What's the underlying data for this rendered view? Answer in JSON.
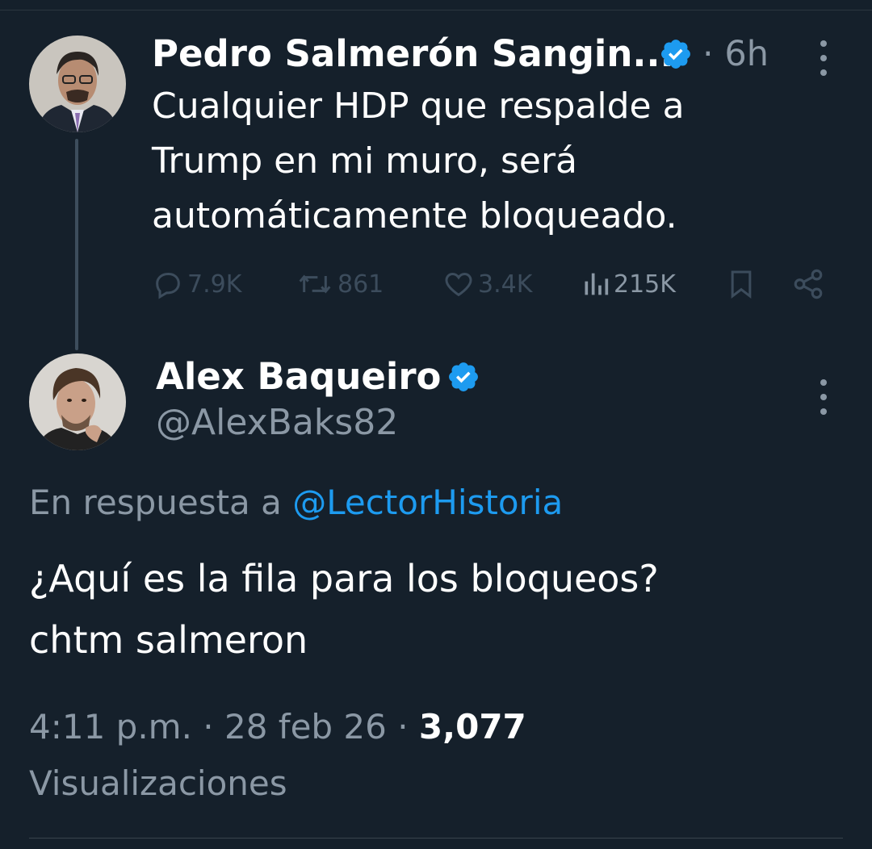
{
  "parent_tweet": {
    "author_name": "Pedro Salmerón Sangin...",
    "time": "6h",
    "text_lines": [
      "Cualquier HDP que respalde a",
      "Trump en mi muro, será",
      "automáticamente bloqueado."
    ],
    "actions": {
      "replies": "7.9K",
      "retweets": "861",
      "likes": "3.4K",
      "views": "215K"
    }
  },
  "reply_tweet": {
    "author_name": "Alex Baqueiro",
    "handle": "@AlexBaks82",
    "in_reply_prefix": "En respuesta a",
    "in_reply_handle": "@LectorHistoria",
    "text_lines": [
      "¿Aquí es la fila para los bloqueos?",
      "chtm salmeron"
    ],
    "timestamp": "4:11 p.m. · 28 feb 26 · ",
    "view_count": "3,077",
    "views_label": "Visualizaciones"
  },
  "colors": {
    "background": "#15202b",
    "verified": "#1d9bf0",
    "link": "#1d9bf0",
    "muted": "#8b98a5"
  }
}
